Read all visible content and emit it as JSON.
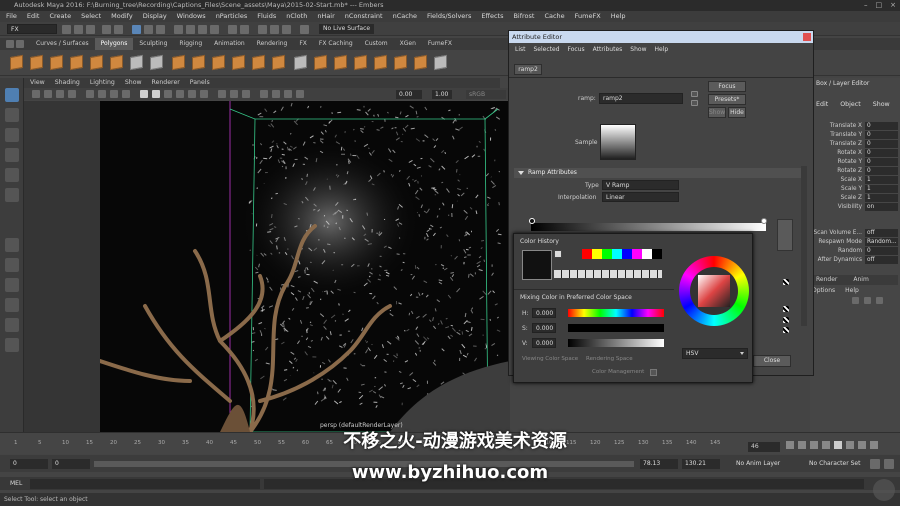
{
  "title_bar": {
    "text": "Autodesk Maya 2016: F:\\Burning_tree\\Recording\\Captions_Files\\Scene_assets\\Maya\\2015-02-Start.mb* --- Embers",
    "controls": [
      "–",
      "□",
      "×"
    ]
  },
  "menu": [
    "File",
    "Edit",
    "Create",
    "Select",
    "Modify",
    "Display",
    "Windows",
    "nParticles",
    "Fluids",
    "nCloth",
    "nHair",
    "nConstraint",
    "nCache",
    "Fields/Solvers",
    "Effects",
    "Bifrost",
    "Cache",
    "FumeFX",
    "Help"
  ],
  "status_line": {
    "mode": "FX",
    "live_surface": "No Live Surface"
  },
  "shelf_tabs": [
    "Curves / Surfaces",
    "Polygons",
    "Sculpting",
    "Rigging",
    "Animation",
    "Rendering",
    "FX",
    "FX Caching",
    "Custom",
    "XGen",
    "FumeFX"
  ],
  "shelf_active_tab": "Polygons",
  "viewport_menu": [
    "View",
    "Shading",
    "Lighting",
    "Show",
    "Renderer",
    "Panels"
  ],
  "viewport_fields": {
    "value1": "0.00",
    "value2": "1.00",
    "colorspace": "sRGB gamma"
  },
  "viewport_label": "persp (defaultRenderLayer)",
  "attribute_editor": {
    "title": "Attribute Editor",
    "menu": [
      "List",
      "Selected",
      "Focus",
      "Attributes",
      "Show",
      "Help"
    ],
    "tab": "ramp2",
    "ramp_label": "ramp:",
    "ramp_name": "ramp2",
    "buttons": {
      "focus": "Focus",
      "presets": "Presets*",
      "show": "Show",
      "hide": "Hide",
      "close": "Close"
    },
    "sample_label": "Sample",
    "section": "Ramp Attributes",
    "type_label": "Type",
    "type_value": "V Ramp",
    "interp_label": "Interpolation",
    "interp_value": "Linear"
  },
  "color_chooser": {
    "history_label": "Color History",
    "mixing_label": "Mixing Color in Preferred Color Space",
    "fields": [
      {
        "label": "H:",
        "value": "0.000"
      },
      {
        "label": "S:",
        "value": "0.000"
      },
      {
        "label": "V:",
        "value": "0.000"
      }
    ],
    "viewing_label": "Viewing Color Space",
    "viewing_value": "Rendering Space",
    "cm_label": "Color Management",
    "mode": "HSV",
    "palette": [
      "#ff0000",
      "#ffff00",
      "#00ff00",
      "#00ffff",
      "#0000ff",
      "#ff00ff",
      "#ffffff",
      "#000000"
    ]
  },
  "channel_box": {
    "header": "Box / Layer Editor",
    "menu": [
      "Edit",
      "Object",
      "Show"
    ],
    "channels": [
      {
        "name": "Translate X",
        "value": "0"
      },
      {
        "name": "Translate Y",
        "value": "0"
      },
      {
        "name": "Translate Z",
        "value": "0"
      },
      {
        "name": "Rotate X",
        "value": "0"
      },
      {
        "name": "Rotate Y",
        "value": "0"
      },
      {
        "name": "Rotate Z",
        "value": "0"
      },
      {
        "name": "Scale X",
        "value": "1"
      },
      {
        "name": "Scale Y",
        "value": "1"
      },
      {
        "name": "Scale Z",
        "value": "1"
      },
      {
        "name": "Visibility",
        "value": "on"
      }
    ],
    "extra": [
      {
        "name": "Scan Volume E...",
        "value": "off"
      },
      {
        "name": "Respawn Mode",
        "value": "Random..."
      },
      {
        "name": "Random",
        "value": "0"
      },
      {
        "name": "After Dynamics",
        "value": "off"
      }
    ],
    "tabs": [
      "Render",
      "Anim"
    ],
    "tab_menu": [
      "Options",
      "Help"
    ]
  },
  "timeline": {
    "frames": [
      "1",
      "5",
      "10",
      "15",
      "20",
      "25",
      "30",
      "35",
      "40",
      "45",
      "50",
      "55",
      "60",
      "65",
      "70",
      "75",
      "80",
      "85",
      "90",
      "95",
      "100",
      "105",
      "110",
      "115",
      "120",
      "125",
      "130",
      "135",
      "140",
      "145"
    ],
    "current": "46"
  },
  "range": {
    "start": "0",
    "inner_start": "0",
    "inner_end": "78.13",
    "end": "130.21",
    "anim_layer": "No Anim Layer",
    "char_set": "No Character Set"
  },
  "mel_label": "MEL",
  "help_line": "Select Tool: select an object",
  "watermark": {
    "line1": "不移之火-动漫游戏美术资源",
    "line2": "www.byzhihuo.com"
  }
}
